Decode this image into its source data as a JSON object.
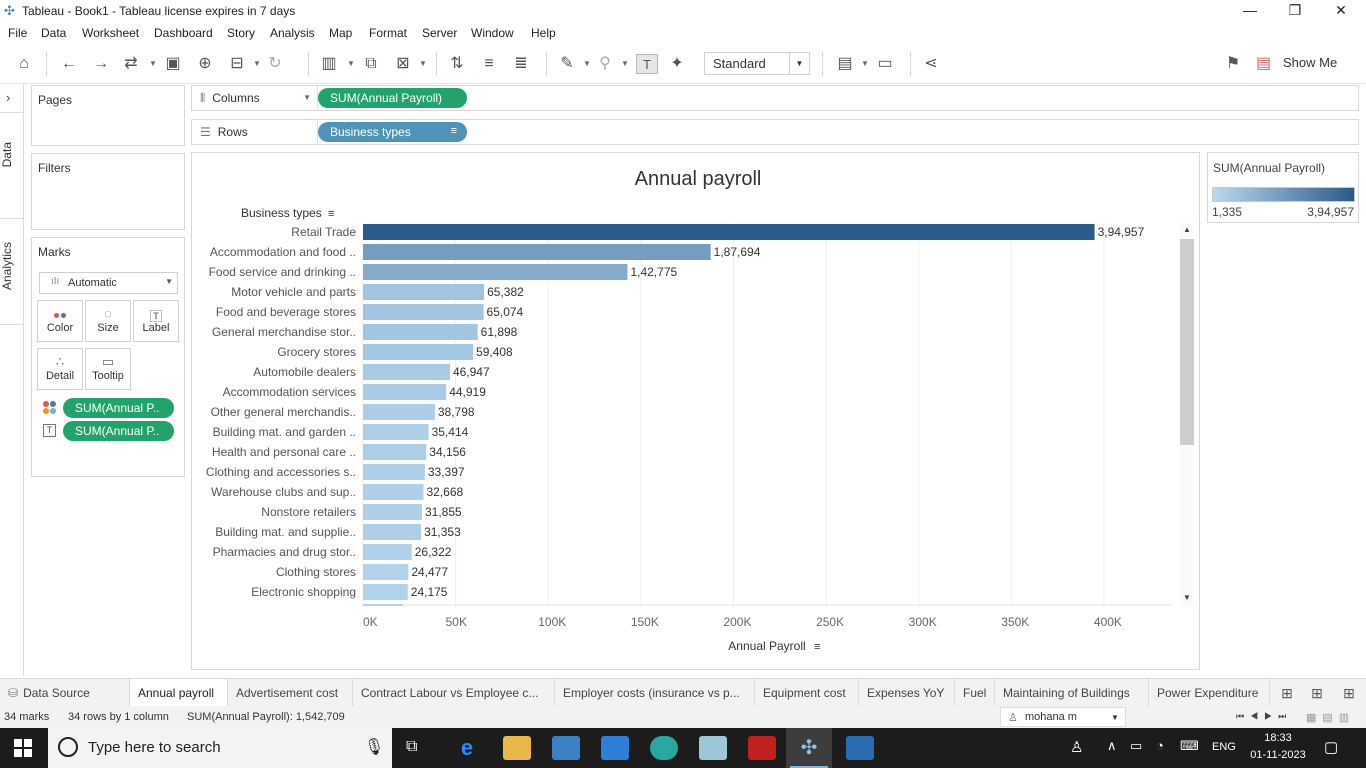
{
  "window": {
    "title": "Tableau - Book1 - Tableau license expires in 7 days",
    "min": "—",
    "restore": "❐",
    "close": "✕"
  },
  "menu": [
    "File",
    "Data",
    "Worksheet",
    "Dashboard",
    "Story",
    "Analysis",
    "Map",
    "Format",
    "Server",
    "Window",
    "Help"
  ],
  "toolbar": {
    "fit_mode": "Standard",
    "show_me": "Show Me"
  },
  "side_tabs": {
    "data": "Data",
    "analytics": "Analytics"
  },
  "pages_card": {
    "title": "Pages"
  },
  "filters_card": {
    "title": "Filters"
  },
  "marks_card": {
    "title": "Marks",
    "mark_type": "Automatic",
    "buttons": [
      {
        "label": "Color",
        "icon": "color-icon"
      },
      {
        "label": "Size",
        "icon": "size-icon"
      },
      {
        "label": "Label",
        "icon": "label-icon"
      },
      {
        "label": "Detail",
        "icon": "detail-icon"
      },
      {
        "label": "Tooltip",
        "icon": "tooltip-icon"
      }
    ],
    "fields": [
      "SUM(Annual P..",
      "SUM(Annual P.."
    ]
  },
  "shelves": {
    "columns_label": "Columns",
    "columns_pill": "SUM(Annual Payroll)",
    "rows_label": "Rows",
    "rows_pill": "Business types"
  },
  "legend": {
    "title": "SUM(Annual Payroll)",
    "min": "1,335",
    "max": "3,94,957",
    "color_low": "#b9d9ef",
    "color_high": "#2c5a8a"
  },
  "chart_data": {
    "type": "bar",
    "title": "Annual payroll",
    "row_header": "Business types",
    "xlabel": "Annual Payroll",
    "xlim": [
      0,
      440000
    ],
    "xticks": [
      "0K",
      "50K",
      "100K",
      "150K",
      "200K",
      "250K",
      "300K",
      "350K",
      "400K"
    ],
    "categories": [
      "Retail Trade",
      "Accommodation and food ..",
      "Food service and drinking ..",
      "Motor vehicle and parts",
      "Food and beverage stores",
      "General merchandise stor..",
      "Grocery stores",
      "Automobile dealers",
      "Accommodation services",
      "Other general merchandis..",
      "Building mat. and garden ..",
      "Health and personal care ..",
      "Clothing and accessories s..",
      "Warehouse clubs and sup..",
      "Nonstore retailers",
      "Building mat. and supplie..",
      "Pharmacies and drug stor..",
      "Clothing stores",
      "Electronic shopping"
    ],
    "values": [
      394957,
      187694,
      142775,
      65382,
      65074,
      61898,
      59408,
      46947,
      44919,
      38798,
      35414,
      34156,
      33397,
      32668,
      31855,
      31353,
      26322,
      24477,
      24175
    ],
    "labels": [
      "3,94,957",
      "1,87,694",
      "1,42,775",
      "65,382",
      "65,074",
      "61,898",
      "59,408",
      "46,947",
      "44,919",
      "38,798",
      "35,414",
      "34,156",
      "33,397",
      "32,668",
      "31,855",
      "31,353",
      "26,322",
      "24,477",
      "24,175"
    ]
  },
  "sheet_tabs": [
    "Data Source",
    "Annual payroll",
    "Advertisement cost",
    "Contract Labour vs Employee c...",
    "Employer costs (insurance vs p...",
    "Equipment cost",
    "Expenses YoY",
    "Fuel",
    "Maintaining of Buildings",
    "Power Expenditure"
  ],
  "status": {
    "marks": "34 marks",
    "rows": "34 rows by 1 column",
    "sum": "SUM(Annual Payroll): 1,542,709",
    "user": "mohana m"
  },
  "taskbar": {
    "search_placeholder": "Type here to search",
    "lang": "ENG",
    "time": "18:33",
    "date": "01-11-2023"
  }
}
